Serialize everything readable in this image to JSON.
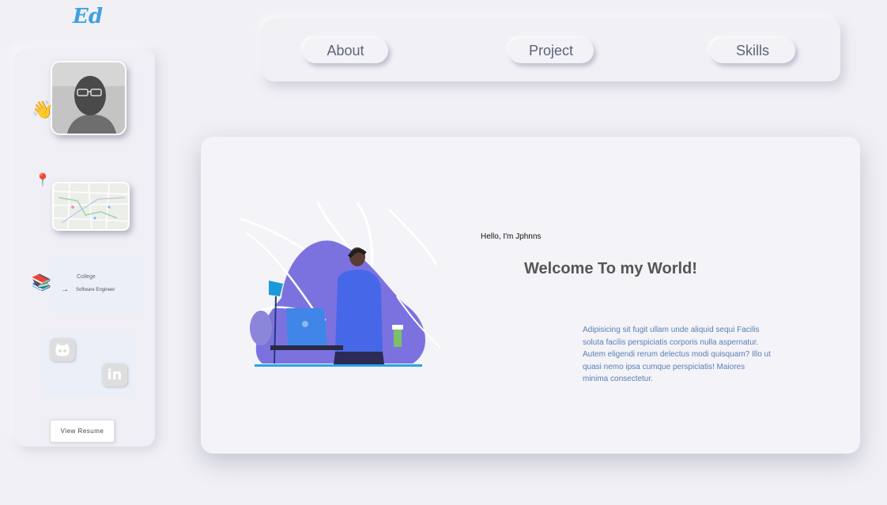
{
  "logo": "Ed",
  "sidebar": {
    "wave_emoji": "👋",
    "pin_emoji": "📍",
    "books_emoji": "📚",
    "education": {
      "school": "College",
      "arrow": "→",
      "role": "Software Engineer"
    },
    "resume_button": "View Resume"
  },
  "nav": {
    "items": [
      {
        "label": "About"
      },
      {
        "label": "Project"
      },
      {
        "label": "Skills"
      }
    ]
  },
  "hero": {
    "greeting": "Hello, I'm Jphnns",
    "headline": "Welcome To my World!",
    "bio": "Adipisicing sit fugit ullam unde aliquid sequi Facilis soluta facilis perspiciatis corporis nulla aspernatur. Autem eligendi rerum delectus modi quisquam? Illo ut quasi nemo ipsa cumque perspiciatis! Maiores minima consectetur."
  },
  "icons": {
    "social": [
      "github-icon",
      "linkedin-icon"
    ],
    "linkedin_text": "in"
  },
  "colors": {
    "background": "#f0f0f5",
    "logo": "#3fa0e0",
    "bio_text": "#5a80b4",
    "nav_text": "#5e6378",
    "illustration_purple": "#7b72e0"
  }
}
